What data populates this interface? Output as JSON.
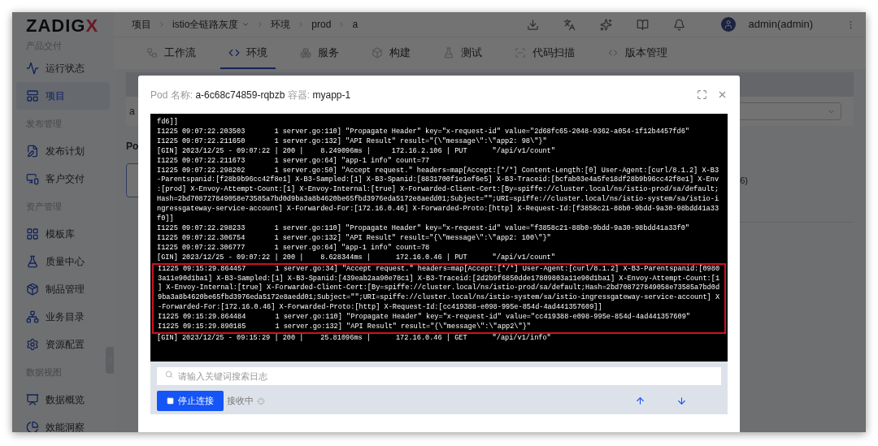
{
  "sidebar": {
    "logo": {
      "text": "ZADIG",
      "accent": "X"
    },
    "sections": [
      {
        "title": "产品交付",
        "items": [
          {
            "label": "运行状态",
            "selected": false
          },
          {
            "label": "项目",
            "selected": true
          }
        ]
      },
      {
        "title": "发布管理",
        "items": [
          {
            "label": "发布计划",
            "selected": false
          },
          {
            "label": "客户交付",
            "selected": false
          }
        ]
      },
      {
        "title": "资产管理",
        "items": [
          {
            "label": "模板库",
            "selected": false
          },
          {
            "label": "质量中心",
            "selected": false
          },
          {
            "label": "制品管理",
            "selected": false
          },
          {
            "label": "业务目录",
            "selected": false
          },
          {
            "label": "资源配置",
            "selected": false
          }
        ]
      },
      {
        "title": "数据视图",
        "items": [
          {
            "label": "数据概览",
            "selected": false
          },
          {
            "label": "效能洞察",
            "selected": false
          }
        ]
      }
    ]
  },
  "topbar": {
    "breadcrumb": [
      {
        "label": "项目",
        "dropdown": false
      },
      {
        "label": "istio全链路灰度",
        "dropdown": true
      },
      {
        "label": "环境",
        "dropdown": false
      },
      {
        "label": "prod",
        "dropdown": false
      },
      {
        "label": "a",
        "dropdown": false
      }
    ],
    "user": "admin(admin)"
  },
  "tabs": [
    {
      "label": "工作流",
      "selected": false
    },
    {
      "label": "环境",
      "selected": true
    },
    {
      "label": "服务",
      "selected": false
    },
    {
      "label": "构建",
      "selected": false
    },
    {
      "label": "测试",
      "selected": false
    },
    {
      "label": "代码扫描",
      "selected": false
    },
    {
      "label": "版本管理",
      "selected": false
    }
  ],
  "content": {
    "row_cell": "a",
    "section_label": "Po",
    "side_text": "6)"
  },
  "modal": {
    "pod_label": "Pod 名称:",
    "pod_name": "a-6c68c74859-rqbzb",
    "container_label": "容器:",
    "container_name": "myapp-1",
    "log": [
      {
        "highlighted": false,
        "lines": [
          "fd6]]",
          "I1225 09:07:22.203503       1 server.go:110] \"Propagate Header\" key=\"x-request-id\" value=\"2d68fc65-2048-9362-a054-1f12b4457fd6\"",
          "I1225 09:07:22.211650       1 server.go:132] \"API Result\" result=\"{\\\"message\\\":\\\"app2: 98\\\"}\"",
          "[GIN] 2023/12/25 - 09:07:22 | 200 |    8.249096ms |     172.16.2.106 | PUT      \"/api/v1/count\"",
          "I1225 09:07:22.211673       1 server.go:64] \"app-1 info\" count=77",
          "I1225 09:07:22.298202       1 server.go:50] \"Accept request.\" headers=map[Accept:[*/*] Content-Length:[0] User-Agent:[curl/8.1.2] X-B3",
          "-Parentspanid:[f28b9b96cc42f8e1] X-B3-Sampled:[1] X-B3-Spanid:[8831700f1e1ef6e5] X-B3-Traceid:[bcfab03e4a5fe18df28b9b96cc42f8e1] X-Env",
          ":[prod] X-Envoy-Attempt-Count:[1] X-Envoy-Internal:[true] X-Forwarded-Client-Cert:[By=spiffe://cluster.local/ns/istio-prod/sa/default;",
          "Hash=2bd708727849058e73585a7bd0d9ba3a8b4620be65fbd3976eda5172e8aedd01;Subject=\"\";URI=spiffe://cluster.local/ns/istio-system/sa/istio-i",
          "ngressgateway-service-account] X-Forwarded-For:[172.16.0.46] X-Forwarded-Proto:[http] X-Request-Id:[f3858c21-88b0-9bdd-9a30-98bdd41a33",
          "f0]]",
          "I1225 09:07:22.298233       1 server.go:110] \"Propagate Header\" key=\"x-request-id\" value=\"f3858c21-88b0-9bdd-9a30-98bdd41a33f0\"",
          "I1225 09:07:22.306754       1 server.go:132] \"API Result\" result=\"{\\\"message\\\":\\\"app2: 100\\\"}\"",
          "I1225 09:07:22.306777       1 server.go:64] \"app-1 info\" count=78",
          "[GIN] 2023/12/25 - 09:07:22 | 200 |    8.628344ms |      172.16.0.46 | PUT      \"/api/v1/count\""
        ]
      },
      {
        "highlighted": true,
        "lines": [
          "I1225 09:15:29.864457       1 server.go:34] \"Accept request.\" headers=map[Accept:[*/*] User-Agent:[curl/8.1.2] X-B3-Parentspanid:[0980",
          "3a11e90d1ba1] X-B3-Sampled:[1] X-B3-Spanid:[439eab2aa90e78c1] X-B3-Traceid:[2d2b9f6850dde17809803a11e90d1ba1] X-Envoy-Attempt-Count:[1",
          "] X-Envoy-Internal:[true] X-Forwarded-Client-Cert:[By=spiffe://cluster.local/ns/istio-prod/sa/default;Hash=2bd708727849058e73585a7bd0d",
          "9ba3a8b4620be65fbd3976eda5172e8aedd01;Subject=\"\";URI=spiffe://cluster.local/ns/istio-system/sa/istio-ingressgateway-service-account] X",
          "-Forwarded-For:[172.16.0.46] X-Forwarded-Proto:[http] X-Request-Id:[cc419388-e098-995e-854d-4ad441357609]]",
          "I1225 09:15:29.864484       1 server.go:110] \"Propagate Header\" key=\"x-request-id\" value=\"cc419388-e098-995e-854d-4ad441357609\"",
          "I1225 09:15:29.890185       1 server.go:132] \"API Result\" result=\"{\\\"message\\\":\\\"app2\\\"}\""
        ]
      },
      {
        "highlighted": false,
        "lines": [
          "[GIN] 2023/12/25 - 09:15:29 | 200 |    25.81096ms |      172.16.0.46 | GET      \"/api/v1/info\""
        ]
      }
    ],
    "search": {
      "placeholder": "请输入关键词搜索日志"
    },
    "stop_button": "停止连接",
    "status": "接收中"
  }
}
